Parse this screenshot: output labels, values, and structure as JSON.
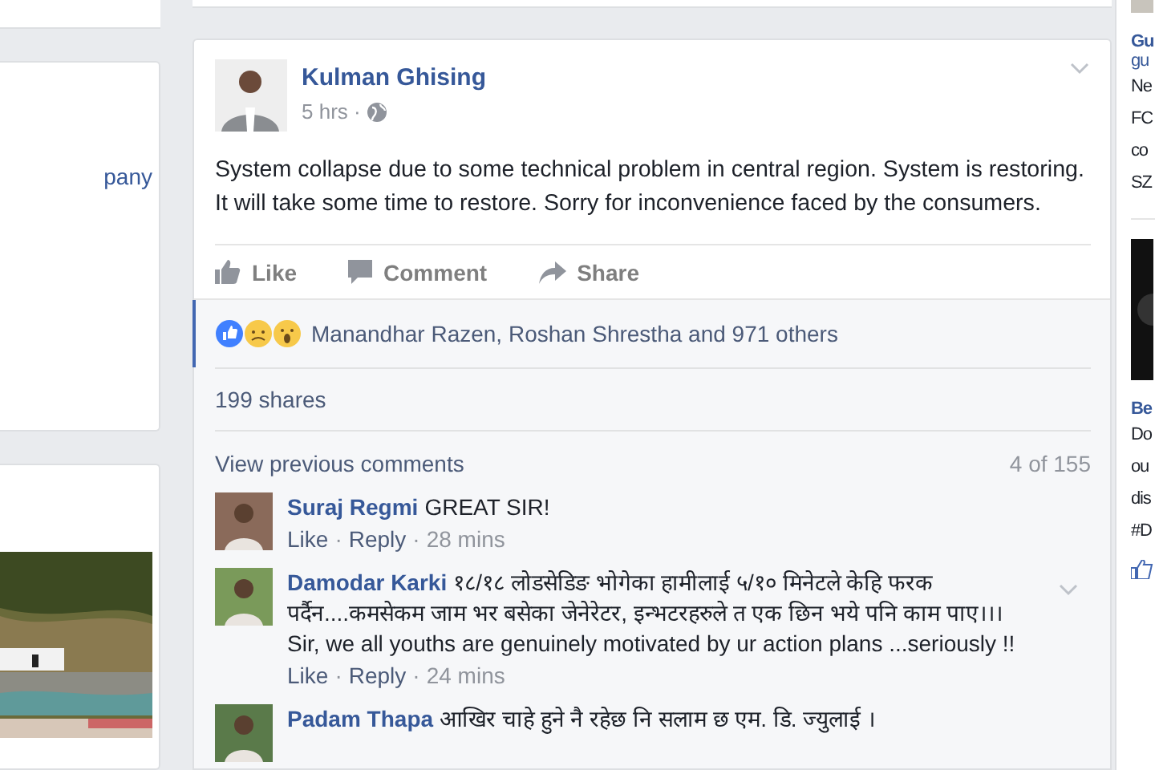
{
  "left_column": {
    "card_text": "pany"
  },
  "post": {
    "author": "Kulman Ghising",
    "time": "5 hrs ·",
    "body": "System collapse due to some technical problem in central region. System is restoring. It will take some time to restore. Sorry for inconvenience faced by the consumers.",
    "actions": [
      {
        "kind": "like",
        "label": "Like"
      },
      {
        "kind": "comment",
        "label": "Comment"
      },
      {
        "kind": "share",
        "label": "Share"
      }
    ],
    "reactions_text": "Manandhar Razen, Roshan Shrestha and 971 others",
    "shares": "199 shares",
    "view_previous": "View previous comments",
    "comment_count": "4 of 155",
    "separator": "·",
    "comments": [
      {
        "author": "Suraj Regmi",
        "text": "GREAT SIR!",
        "like": "Like",
        "reply": "Reply",
        "time": "28 mins",
        "has_menu": false
      },
      {
        "author": "Damodar Karki",
        "text": "१८/१८ लोडसेडिङ भोगेका हामीलाई ५/१० मिनेटले केहि फरक पर्दैन....कमसेकम जाम भर बसेका जेनेरेटर, इन्भटरहरुले त एक छिन भये पनि काम पाए।।।",
        "text_2": "Sir, we all youths are genuinely motivated by ur action plans ...seriously !!",
        "like": "Like",
        "reply": "Reply",
        "time": "24 mins",
        "has_menu": true
      },
      {
        "author": "Padam Thapa",
        "text": "आखिर चाहे हुने नै रहेछ नि सलाम छ एम. डि. ज्युलाई ।",
        "has_menu": false
      }
    ]
  },
  "right_column": {
    "title": "Gu",
    "subtitle": "gu",
    "lines": [
      "Ne",
      "FC",
      "co",
      "SZ"
    ],
    "title_2": "Be",
    "lines_2": [
      "Do",
      "ou",
      "dis",
      "#D"
    ]
  }
}
